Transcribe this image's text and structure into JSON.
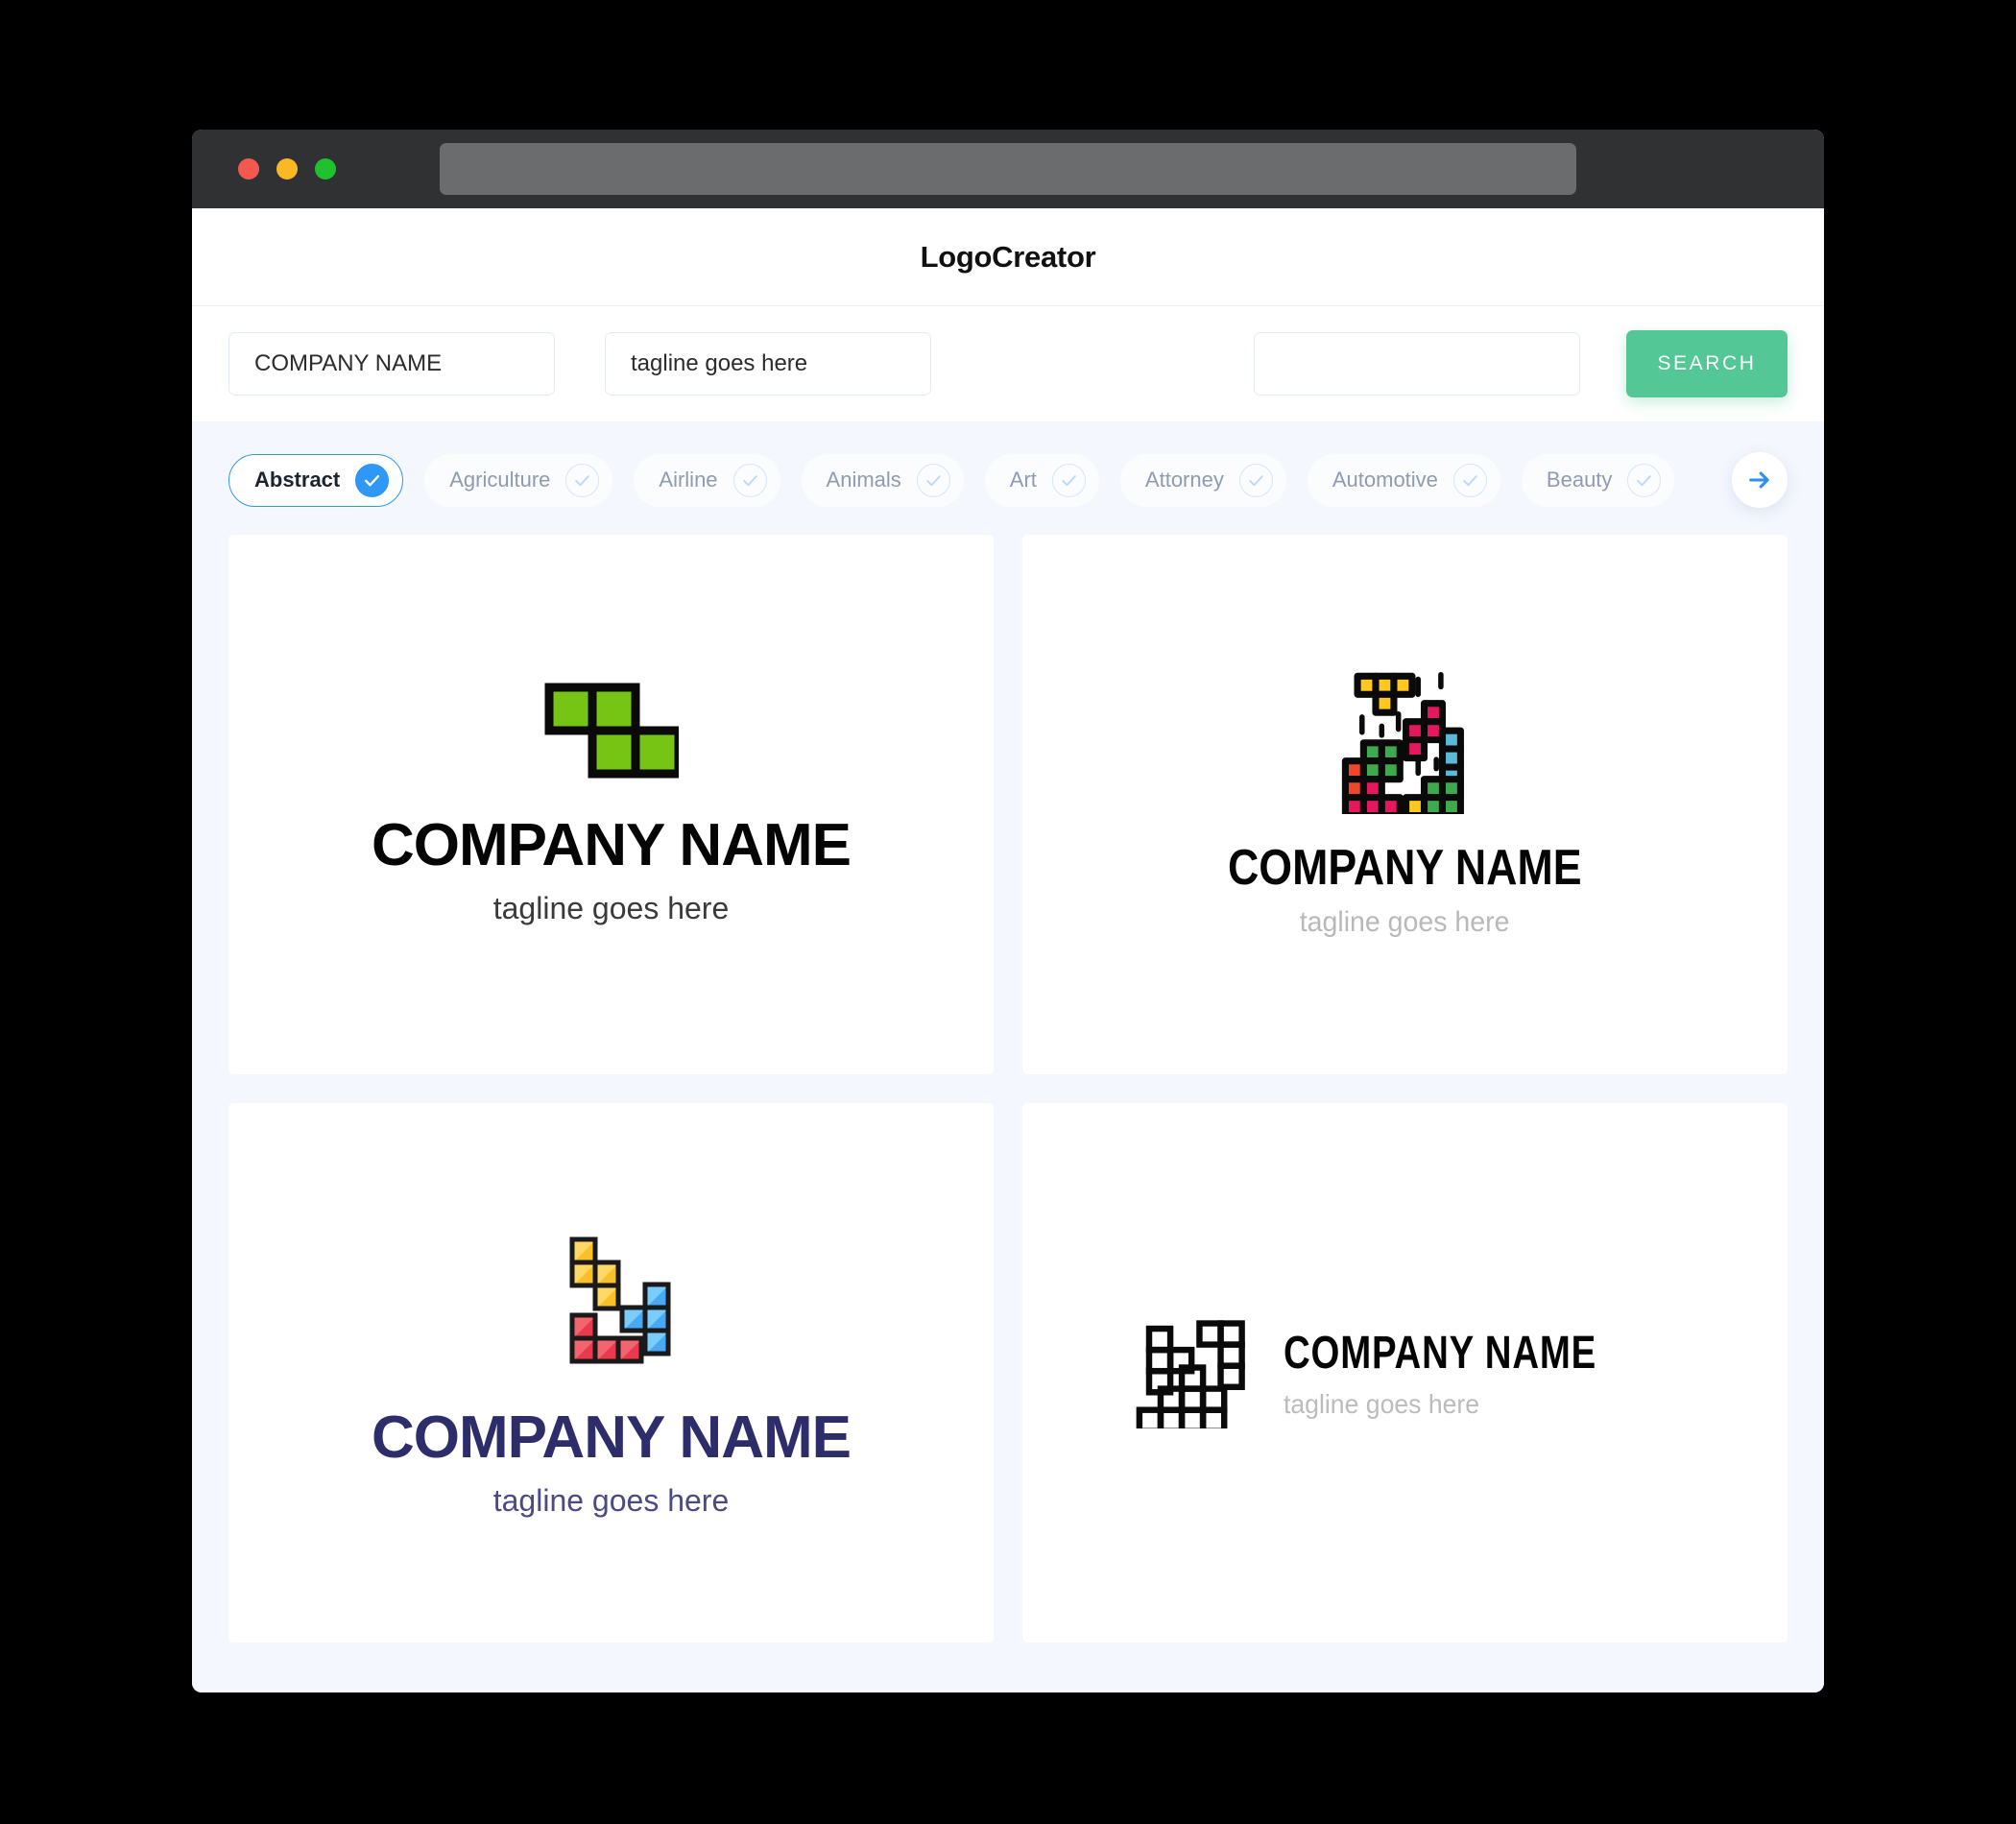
{
  "window": {
    "traffic_lights": [
      "close",
      "minimize",
      "zoom"
    ],
    "url_bar_value": ""
  },
  "header": {
    "title": "LogoCreator"
  },
  "search": {
    "company_name_value": "COMPANY NAME",
    "company_name_placeholder": "COMPANY NAME",
    "tagline_value": "tagline goes here",
    "tagline_placeholder": "tagline goes here",
    "extra_value": "",
    "extra_placeholder": "",
    "search_button_label": "SEARCH"
  },
  "categories": {
    "next_arrow_icon": "arrow-right-icon",
    "items": [
      {
        "label": "Abstract",
        "selected": true
      },
      {
        "label": "Agriculture",
        "selected": false
      },
      {
        "label": "Airline",
        "selected": false
      },
      {
        "label": "Animals",
        "selected": false
      },
      {
        "label": "Art",
        "selected": false
      },
      {
        "label": "Attorney",
        "selected": false
      },
      {
        "label": "Automotive",
        "selected": false
      },
      {
        "label": "Beauty",
        "selected": false
      }
    ]
  },
  "results": {
    "cards": [
      {
        "id": "card1",
        "art": "green-s-tetromino",
        "name": "COMPANY NAME",
        "tagline": "tagline goes here",
        "name_color": "#050505",
        "tagline_color": "#3a3a3a",
        "accent_color": "#76c414",
        "layout": "stacked"
      },
      {
        "id": "card2",
        "art": "colorful-tetris-city",
        "name": "COMPANY NAME",
        "tagline": "tagline goes here",
        "name_color": "#050505",
        "tagline_color": "#b9b9b9",
        "accent_colors": [
          "#ffc81f",
          "#e5175e",
          "#3eaa4d",
          "#f0462a",
          "#5bb8d6"
        ],
        "layout": "stacked"
      },
      {
        "id": "card3",
        "art": "pastel-tetromino-trio",
        "name": "COMPANY NAME",
        "tagline": "tagline goes here",
        "name_color": "#2e2d6b",
        "tagline_color": "#4b4a85",
        "accent_colors": [
          "#fcd34a",
          "#54b4fb",
          "#f1505f"
        ],
        "layout": "stacked"
      },
      {
        "id": "card4",
        "art": "outline-tetromino-blocks",
        "name": "COMPANY NAME",
        "tagline": "tagline goes here",
        "name_color": "#050505",
        "tagline_color": "#bcbcbc",
        "accent_color": "#000000",
        "layout": "horizontal"
      }
    ]
  },
  "colors": {
    "page_background": "#000000",
    "window_background": "#ffffff",
    "body_background": "#f4f7fd",
    "titlebar": "#2f3132",
    "urlbar": "#6b6c6d",
    "search_button": "#53c796",
    "chip_selected_border": "#2f97f5",
    "chip_text": "#8f9bb0",
    "traffic_red": "#f4594f",
    "traffic_yellow": "#f9b824",
    "traffic_green": "#1fc22d"
  }
}
